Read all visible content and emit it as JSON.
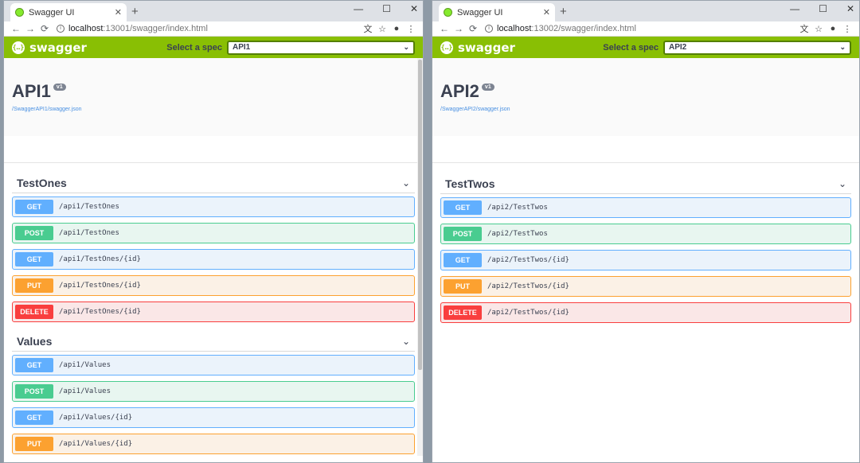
{
  "windows": [
    {
      "tab_title": "Swagger UI",
      "url_host": "localhost",
      "url_path": ":13001/swagger/index.html",
      "logo_text": "swagger",
      "spec_label": "Select a spec",
      "spec_value": "API1",
      "api_title": "API1",
      "version": "v1",
      "spec_url": "/SwaggerAPI1/swagger.json",
      "tags": [
        {
          "name": "TestOnes",
          "ops": [
            {
              "method": "GET",
              "path": "/api1/TestOnes"
            },
            {
              "method": "POST",
              "path": "/api1/TestOnes"
            },
            {
              "method": "GET",
              "path": "/api1/TestOnes/{id}"
            },
            {
              "method": "PUT",
              "path": "/api1/TestOnes/{id}"
            },
            {
              "method": "DELETE",
              "path": "/api1/TestOnes/{id}"
            }
          ]
        },
        {
          "name": "Values",
          "ops": [
            {
              "method": "GET",
              "path": "/api1/Values"
            },
            {
              "method": "POST",
              "path": "/api1/Values"
            },
            {
              "method": "GET",
              "path": "/api1/Values/{id}"
            },
            {
              "method": "PUT",
              "path": "/api1/Values/{id}"
            }
          ]
        }
      ]
    },
    {
      "tab_title": "Swagger UI",
      "url_host": "localhost",
      "url_path": ":13002/swagger/index.html",
      "logo_text": "swagger",
      "spec_label": "Select a spec",
      "spec_value": "API2",
      "api_title": "API2",
      "version": "v1",
      "spec_url": "/SwaggerAPI2/swagger.json",
      "tags": [
        {
          "name": "TestTwos",
          "ops": [
            {
              "method": "GET",
              "path": "/api2/TestTwos"
            },
            {
              "method": "POST",
              "path": "/api2/TestTwos"
            },
            {
              "method": "GET",
              "path": "/api2/TestTwos/{id}"
            },
            {
              "method": "PUT",
              "path": "/api2/TestTwos/{id}"
            },
            {
              "method": "DELETE",
              "path": "/api2/TestTwos/{id}"
            }
          ]
        }
      ]
    }
  ],
  "colors": {
    "topbar": "#89bf04",
    "get": "#61affe",
    "post": "#49cc90",
    "put": "#fca130",
    "delete": "#f93e3e"
  }
}
